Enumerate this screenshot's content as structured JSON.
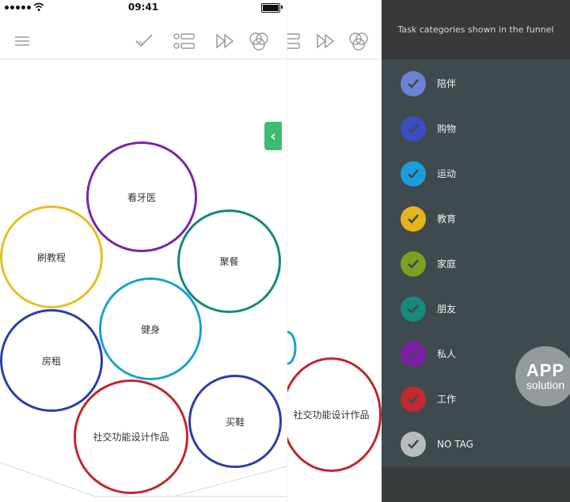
{
  "status_bar": {
    "time": "09:41"
  },
  "main": {
    "bubbles": [
      {
        "label": "看牙医",
        "color": "#7a27a8"
      },
      {
        "label": "刷教程",
        "color": "#e4c021"
      },
      {
        "label": "聚餐",
        "color": "#18877a"
      },
      {
        "label": "健身",
        "color": "#1aa2cf"
      },
      {
        "label": "房租",
        "color": "#2b3ea8"
      },
      {
        "label": "社交功能设计作品",
        "color": "#c1262d"
      },
      {
        "label": "买鞋",
        "color": "#2b3ea8"
      }
    ]
  },
  "mid": {
    "bubble_label": "社交功能设计作品",
    "bubble_color": "#c1262d"
  },
  "drawer": {
    "header": "Task categories shown in the funnel",
    "items": [
      {
        "label": "陪伴",
        "color": "#6b83d6"
      },
      {
        "label": "购物",
        "color": "#3a4fc1"
      },
      {
        "label": "运动",
        "color": "#1b9ddc"
      },
      {
        "label": "教育",
        "color": "#e3b41b"
      },
      {
        "label": "家庭",
        "color": "#7ea01f"
      },
      {
        "label": "朋友",
        "color": "#168a7c"
      },
      {
        "label": "私人",
        "color": "#7b1fa6"
      },
      {
        "label": "工作",
        "color": "#c42a31"
      },
      {
        "label": "NO TAG",
        "color": "#b8bcbe"
      }
    ]
  },
  "watermark": {
    "line1": "APP",
    "line2": "solution"
  }
}
